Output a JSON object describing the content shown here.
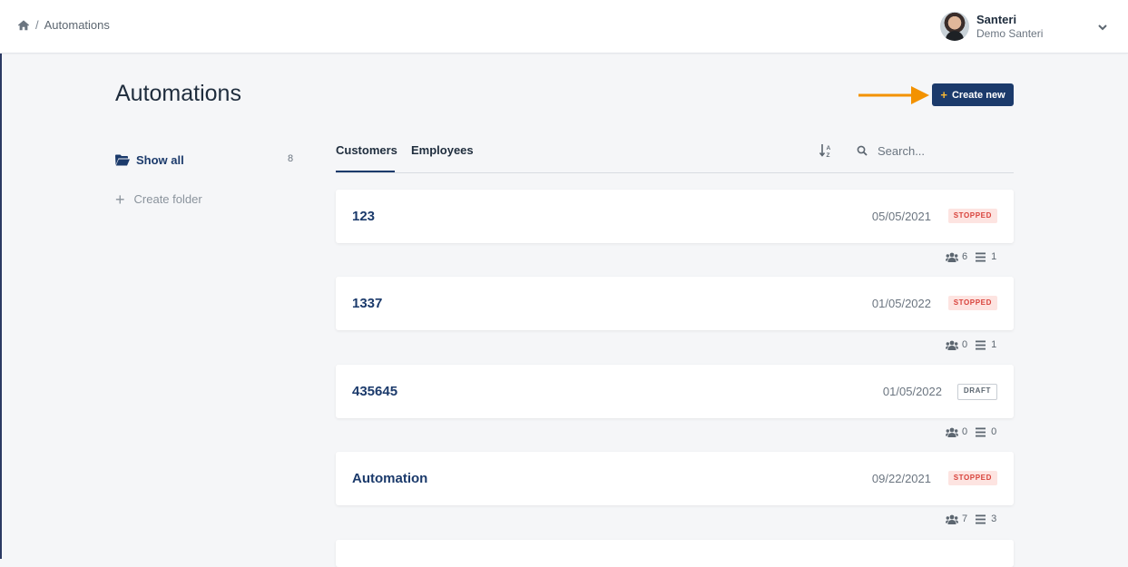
{
  "breadcrumb": {
    "separator": "/",
    "current": "Automations"
  },
  "user": {
    "name": "Santeri",
    "organization": "Demo Santeri"
  },
  "page": {
    "title": "Automations",
    "create_label": "Create new",
    "create_icon": "+"
  },
  "sidebar": {
    "show_all_label": "Show all",
    "show_all_count": "8",
    "create_folder_label": "Create folder"
  },
  "tabs": [
    {
      "label": "Customers",
      "active": true
    },
    {
      "label": "Employees",
      "active": false
    }
  ],
  "search": {
    "placeholder": "Search..."
  },
  "automations": [
    {
      "name": "123",
      "date": "05/05/2021",
      "status": "STOPPED",
      "contacts": "6",
      "steps": "1"
    },
    {
      "name": "1337",
      "date": "01/05/2022",
      "status": "STOPPED",
      "contacts": "0",
      "steps": "1"
    },
    {
      "name": "435645",
      "date": "01/05/2022",
      "status": "DRAFT",
      "contacts": "0",
      "steps": "0"
    },
    {
      "name": "Automation",
      "date": "09/22/2021",
      "status": "STOPPED",
      "contacts": "7",
      "steps": "3"
    }
  ],
  "colors": {
    "primary": "#1b3a6b",
    "accent_arrow": "#f39200",
    "stopped_bg": "#fde4e1",
    "stopped_text": "#d8413a"
  },
  "icons": {
    "home": "home-icon",
    "chevron": "chevron-down-icon",
    "folder": "folder-open-icon",
    "sort": "sort-alpha-icon",
    "search": "search-icon",
    "users": "users-icon",
    "list": "list-icon"
  }
}
